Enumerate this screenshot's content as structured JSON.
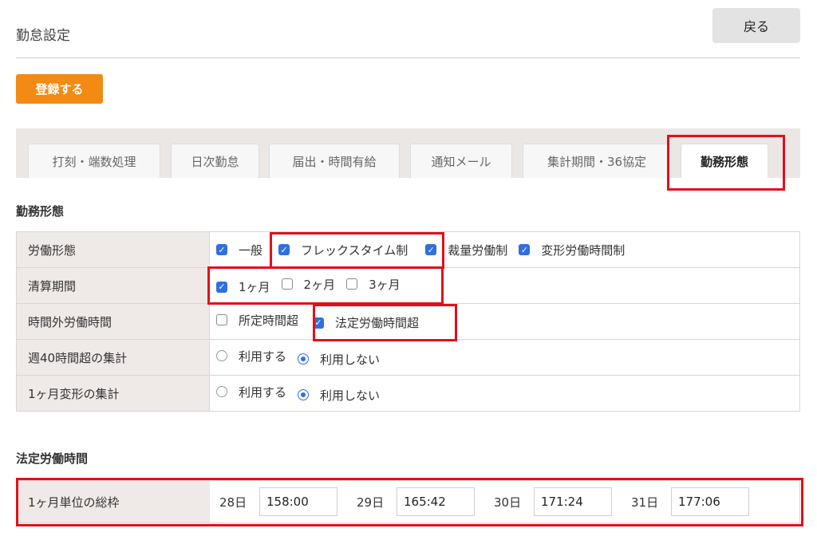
{
  "header": {
    "title": "勤怠設定",
    "back_label": "戻る"
  },
  "toolbar": {
    "register_label": "登録する"
  },
  "tabs": [
    {
      "label": "打刻・端数処理",
      "active": false
    },
    {
      "label": "日次勤怠",
      "active": false
    },
    {
      "label": "届出・時間有給",
      "active": false
    },
    {
      "label": "通知メール",
      "active": false
    },
    {
      "label": "集計期間・36協定",
      "active": false
    },
    {
      "label": "勤務形態",
      "active": true
    }
  ],
  "work_style": {
    "section_title": "勤務形態",
    "rows": [
      {
        "label": "労働形態",
        "options": [
          {
            "label": "一般",
            "checked": true
          },
          {
            "label": "フレックスタイム制",
            "checked": true
          },
          {
            "label": "裁量労働制",
            "checked": true
          },
          {
            "label": "変形労働時間制",
            "checked": true
          }
        ]
      },
      {
        "label": "清算期間",
        "options": [
          {
            "label": "1ヶ月",
            "checked": true
          },
          {
            "label": "2ヶ月",
            "checked": false
          },
          {
            "label": "3ヶ月",
            "checked": false
          }
        ]
      },
      {
        "label": "時間外労働時間",
        "options": [
          {
            "label": "所定時間超",
            "checked": false
          },
          {
            "label": "法定労働時間超",
            "checked": true
          }
        ]
      },
      {
        "label": "週40時間超の集計",
        "options": [
          {
            "label": "利用する",
            "selected": false
          },
          {
            "label": "利用しない",
            "selected": true
          }
        ]
      },
      {
        "label": "1ヶ月変形の集計",
        "options": [
          {
            "label": "利用する",
            "selected": false
          },
          {
            "label": "利用しない",
            "selected": true
          }
        ]
      }
    ]
  },
  "legal_hours": {
    "section_title": "法定労働時間",
    "row_label": "1ヶ月単位の総枠",
    "entries": [
      {
        "day": "28日",
        "value": "158:00"
      },
      {
        "day": "29日",
        "value": "165:42"
      },
      {
        "day": "30日",
        "value": "171:24"
      },
      {
        "day": "31日",
        "value": "177:06"
      }
    ]
  },
  "colors": {
    "accent": "#f28a13",
    "highlight": "#e0101a",
    "check": "#2f6fe0",
    "label_bg": "#efe9e8"
  }
}
